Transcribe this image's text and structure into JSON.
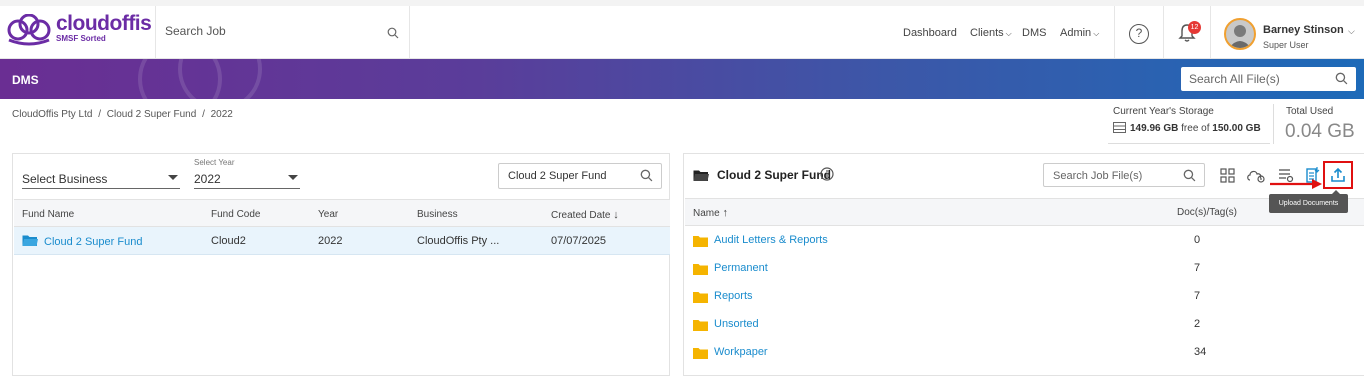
{
  "app": {
    "brand": "cloudoffis",
    "tagline": "SMSF Sorted"
  },
  "header": {
    "search_placeholder": "Search Job",
    "nav": {
      "dashboard": "Dashboard",
      "clients": "Clients",
      "dms": "DMS",
      "admin": "Admin"
    },
    "notifications_count": "12",
    "user": {
      "name": "Barney Stinson",
      "role": "Super User"
    }
  },
  "banner": {
    "title": "DMS",
    "search_placeholder": "Search All File(s)"
  },
  "breadcrumb": [
    "CloudOffis Pty Ltd",
    "Cloud 2 Super Fund",
    "2022"
  ],
  "storage": {
    "label": "Current Year's Storage",
    "free": "149.96 GB",
    "free_of_text": "free of",
    "total": "150.00 GB",
    "total_used_label": "Total Used",
    "total_used": "0.04 GB"
  },
  "left": {
    "business_select": "Select Business",
    "year_label": "Select Year",
    "year_value": "2022",
    "fund_search_value": "Cloud 2 Super Fund",
    "columns": [
      "Fund Name",
      "Fund Code",
      "Year",
      "Business",
      "Created Date"
    ],
    "rows": [
      {
        "fund_name": "Cloud 2 Super Fund",
        "fund_code": "Cloud2",
        "year": "2022",
        "business": "CloudOffis Pty ...",
        "created": "07/07/2025"
      }
    ]
  },
  "right": {
    "title": "Cloud 2 Super Fund",
    "search_placeholder": "Search Job File(s)",
    "columns": [
      "Name",
      "Doc(s)/Tag(s)"
    ],
    "tooltip": "Upload Documents",
    "folders": [
      {
        "name": "Audit Letters & Reports",
        "count": "0"
      },
      {
        "name": "Permanent",
        "count": "7"
      },
      {
        "name": "Reports",
        "count": "7"
      },
      {
        "name": "Unsorted",
        "count": "2"
      },
      {
        "name": "Workpaper",
        "count": "34"
      }
    ]
  },
  "colors": {
    "link": "#1a8ccd",
    "folder": "#f5b400",
    "brand": "#6b2ca5",
    "highlight": "#e01010"
  }
}
